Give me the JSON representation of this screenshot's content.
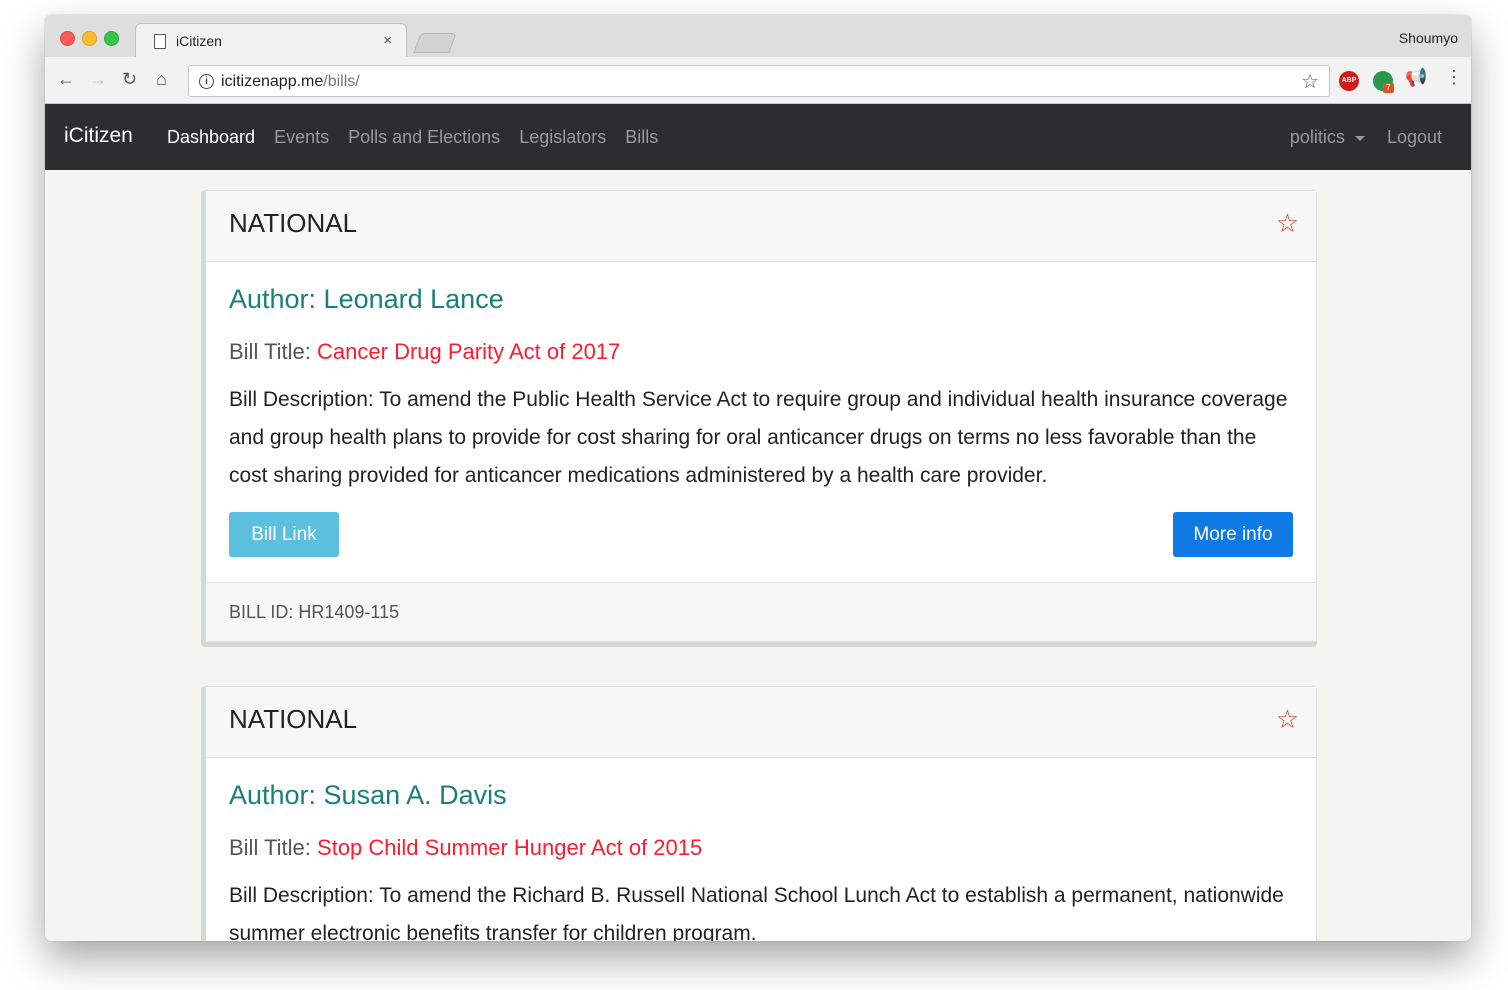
{
  "browser": {
    "tab_title": "iCitizen",
    "tab_close": "×",
    "profile_name": "Shoumyo",
    "url_host": "icitizenapp.me",
    "url_path": "/bills/",
    "abp_label": "ABP",
    "ext_badge": "7"
  },
  "navbar": {
    "brand": "iCitizen",
    "items": [
      "Dashboard",
      "Events",
      "Polls and Elections",
      "Legislators",
      "Bills"
    ],
    "dropdown_label": "politics",
    "logout_label": "Logout"
  },
  "bills": [
    {
      "region": "NATIONAL",
      "author": "Author: Leonard Lance",
      "title_label": "Bill Title: ",
      "title": "Cancer Drug Parity Act of 2017",
      "description": "Bill Description: To amend the Public Health Service Act to require group and individual health insurance coverage and group health plans to provide for cost sharing for oral anticancer drugs on terms no less favorable than the cost sharing provided for anticancer medications administered by a health care provider.",
      "link_label": "Bill Link",
      "more_label": "More info",
      "bill_id": "BILL ID: HR1409-115"
    },
    {
      "region": "NATIONAL",
      "author": "Author: Susan A. Davis",
      "title_label": "Bill Title: ",
      "title": "Stop Child Summer Hunger Act of 2015",
      "description": "Bill Description: To amend the Richard B. Russell National School Lunch Act to establish a permanent, nationwide summer electronic benefits transfer for children program."
    }
  ],
  "colors": {
    "navbar_bg": "#2b2d2f",
    "author": "#1a7f7a",
    "bill_title": "#ff1a2e",
    "btn_link": "#5bc0de",
    "btn_more": "#0e7ae6",
    "star": "#e0362e"
  }
}
